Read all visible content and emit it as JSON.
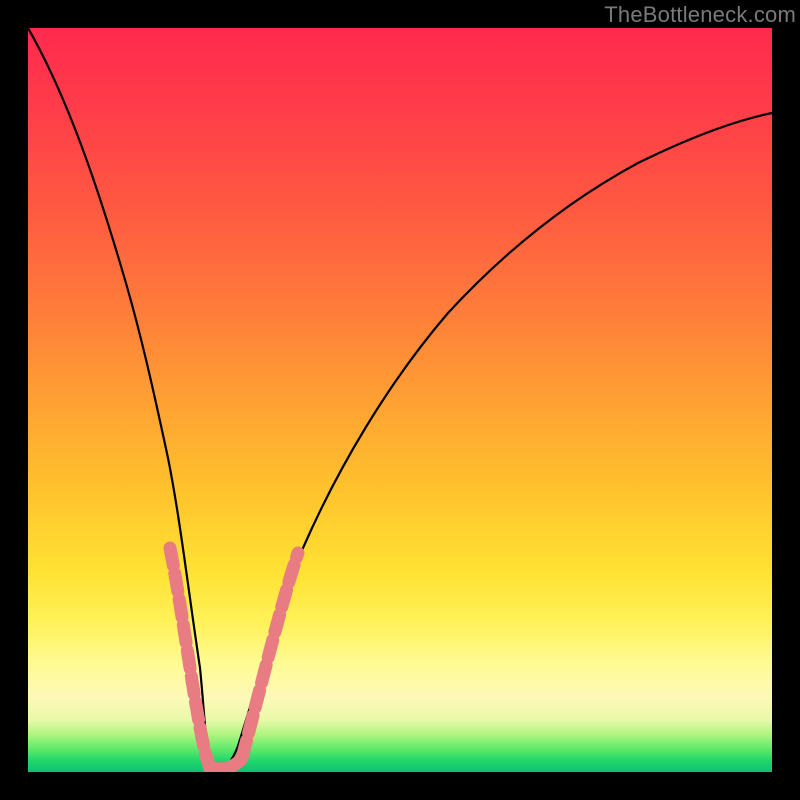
{
  "watermark": "TheBottleneck.com",
  "colors": {
    "background_top": "#ff2a4d",
    "background_mid": "#ffe233",
    "background_bottom": "#0fc074",
    "frame": "#000000",
    "curve": "#000000",
    "nodes": "#e97b82",
    "watermark_text": "#7a7a7a"
  },
  "chart_data": {
    "type": "line",
    "title": "",
    "xlabel": "",
    "ylabel": "",
    "xlim": [
      0,
      100
    ],
    "ylim": [
      0,
      100
    ],
    "series": [
      {
        "name": "bottleneck-curve",
        "x": [
          0,
          3,
          6,
          9,
          12,
          15,
          18,
          21,
          22.5,
          24,
          26,
          28,
          32,
          38,
          45,
          55,
          65,
          75,
          85,
          95,
          100
        ],
        "y": [
          100,
          88,
          76,
          64,
          52,
          40,
          26,
          12,
          4,
          0,
          3,
          9,
          22,
          38,
          52,
          65,
          74,
          80,
          84,
          87,
          88
        ]
      }
    ],
    "highlighted_nodes": {
      "left_branch_x_range": [
        16,
        24
      ],
      "right_branch_x_range": [
        24,
        31
      ],
      "approx_y_range": [
        0,
        30
      ]
    },
    "gradient_encoding": "vertical color gradient: red (high bottleneck) → yellow → green (no bottleneck)",
    "minimum_at_x_pct": 24
  }
}
